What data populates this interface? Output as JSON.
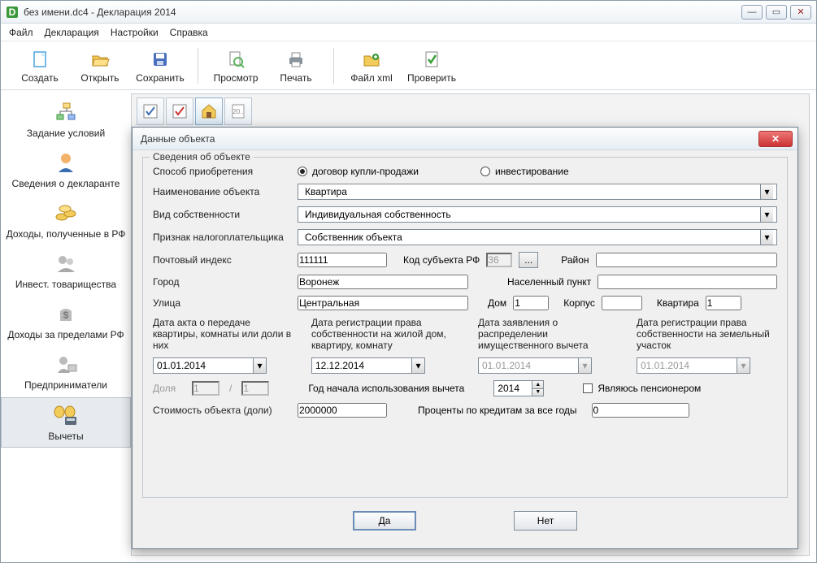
{
  "window": {
    "title": "без имени.dc4 - Декларация 2014",
    "menus": [
      "Файл",
      "Декларация",
      "Настройки",
      "Справка"
    ]
  },
  "toolbar": [
    {
      "id": "create",
      "label": "Создать",
      "icon": "file-new-icon",
      "color": "#4aa3df"
    },
    {
      "id": "open",
      "label": "Открыть",
      "icon": "folder-open-icon",
      "color": "#e7b93b"
    },
    {
      "id": "save",
      "label": "Сохранить",
      "icon": "disk-icon",
      "color": "#4a6fbf"
    },
    {
      "id": "sep1",
      "sep": true
    },
    {
      "id": "preview",
      "label": "Просмотр",
      "icon": "preview-icon",
      "color": "#5db55d"
    },
    {
      "id": "print",
      "label": "Печать",
      "icon": "printer-icon",
      "color": "#8895a0"
    },
    {
      "id": "sep2",
      "sep": true
    },
    {
      "id": "xml",
      "label": "Файл xml",
      "icon": "xml-icon",
      "color": "#e7b93b"
    },
    {
      "id": "check",
      "label": "Проверить",
      "icon": "check-icon",
      "color": "#3aa03a"
    }
  ],
  "sidebar": {
    "items": [
      {
        "id": "conditions",
        "label": "Задание условий",
        "icon": "tree-icon"
      },
      {
        "id": "declarant",
        "label": "Сведения о декларанте",
        "icon": "user-icon"
      },
      {
        "id": "income",
        "label": "Доходы, полученные в РФ",
        "icon": "coins-icon"
      },
      {
        "id": "invest",
        "label": "Инвест. товарищества",
        "icon": "partner-icon",
        "disabled": true
      },
      {
        "id": "abroad",
        "label": "Доходы за пределами РФ",
        "icon": "bag-icon",
        "disabled": true
      },
      {
        "id": "entrepreneur",
        "label": "Предприниматели",
        "icon": "entrepreneur-icon",
        "disabled": true
      },
      {
        "id": "deductions",
        "label": "Вычеты",
        "icon": "deductions-icon",
        "selected": true
      }
    ]
  },
  "subtoolbar": [
    {
      "id": "tab-standard",
      "icon": "check-page-icon"
    },
    {
      "id": "tab-social",
      "icon": "check-red-icon"
    },
    {
      "id": "tab-property",
      "icon": "house-icon",
      "active": true
    },
    {
      "id": "tab-losses",
      "icon": "doc-20-icon",
      "label": "20.."
    }
  ],
  "dialog": {
    "title": "Данные объекта",
    "group_title": "Сведения об объекте",
    "labels": {
      "acquisition": "Способ приобретения",
      "radio_purchase": "договор купли-продажи",
      "radio_invest": "инвестирование",
      "object_name": "Наименование объекта",
      "ownership": "Вид собственности",
      "taxpayer": "Признак налогоплательщика",
      "postcode": "Почтовый индекс",
      "region_code": "Код субъекта РФ",
      "district": "Район",
      "city": "Город",
      "settlement": "Населенный пункт",
      "street": "Улица",
      "house": "Дом",
      "block": "Корпус",
      "apartment": "Квартира",
      "date_act": "Дата акта о передаче квартиры, комнаты или доли в них",
      "date_reg_flat": "Дата регистрации права собственности на жилой дом, квартиру, комнату",
      "date_decl": "Дата заявления о распределении имущественного вычета",
      "date_reg_land": "Дата регистрации права собственности на земельный участок",
      "share": "Доля",
      "year_start": "Год начала использования вычета",
      "pensioner": "Являюсь пенсионером",
      "cost": "Стоимость объекта (доли)",
      "interest": "Проценты по кредитам за все годы",
      "ok": "Да",
      "cancel": "Нет"
    },
    "values": {
      "object_name": "Квартира",
      "ownership": "Индивидуальная собственность",
      "taxpayer": "Собственник объекта",
      "postcode": "111111",
      "region_code": "36",
      "district": "",
      "city": "Воронеж",
      "settlement": "",
      "street": "Центральная",
      "house": "1",
      "block": "",
      "apartment": "1",
      "date_act": "01.01.2014",
      "date_reg_flat": "12.12.2014",
      "date_decl": "01.01.2014",
      "date_reg_land": "01.01.2014",
      "share_num": "1",
      "share_den": "1",
      "year_start": "2014",
      "cost": "2000000",
      "interest": "0"
    },
    "radio_selected": "purchase"
  }
}
